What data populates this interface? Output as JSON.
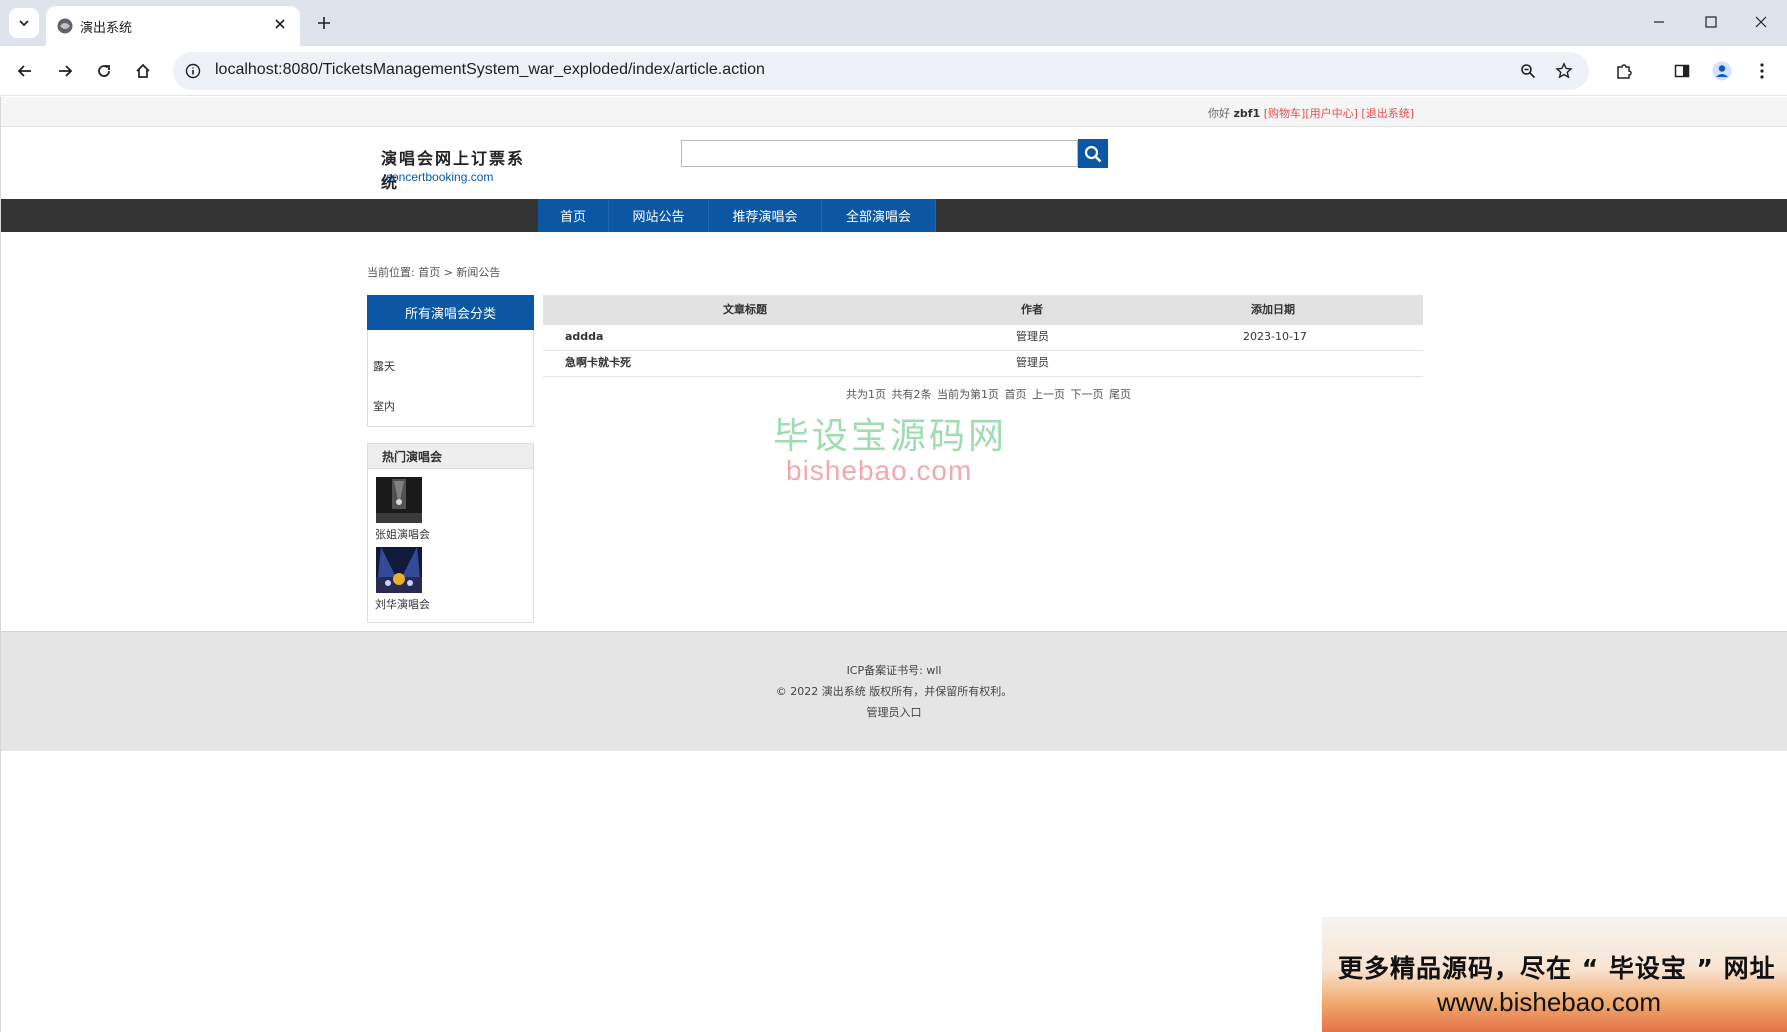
{
  "browser": {
    "tab_title": "演出系统",
    "url": "localhost:8080/TicketsManagementSystem_war_exploded/index/article.action"
  },
  "topbar": {
    "greeting": "你好",
    "username": "zbf1",
    "cart_link": "[购物车]",
    "user_center_link": "[用户中心]",
    "logout_link": "[退出系统]"
  },
  "header": {
    "logo_cn": "演唱会网上订票系统",
    "logo_en": "concertbooking.com",
    "search_placeholder": ""
  },
  "nav": {
    "items": [
      {
        "label": "首页"
      },
      {
        "label": "网站公告"
      },
      {
        "label": "推荐演唱会"
      },
      {
        "label": "全部演唱会"
      }
    ]
  },
  "breadcrumb": "当前位置: 首页 > 新闻公告",
  "sidebar": {
    "categories_title": "所有演唱会分类",
    "categories": [
      {
        "label": "露天"
      },
      {
        "label": "室内"
      }
    ],
    "hot_title": "热门演唱会",
    "hot": [
      {
        "label": "张姐演唱会"
      },
      {
        "label": "刘华演唱会"
      }
    ]
  },
  "articles": {
    "headers": {
      "title": "文章标题",
      "author": "作者",
      "date": "添加日期"
    },
    "rows": [
      {
        "title": "addda",
        "author": "管理员",
        "date": "2023-10-17"
      },
      {
        "title": "急啊卡就卡死",
        "author": "管理员",
        "date": ""
      }
    ],
    "pager": {
      "total_pages": "共为1页",
      "total_items": "共有2条",
      "current": "当前为第1页",
      "first": "首页",
      "prev": "上一页",
      "next": "下一页",
      "last": "尾页"
    }
  },
  "watermark": {
    "cn": "毕设宝源码网",
    "en": "bishebao.com"
  },
  "footer": {
    "icp": "ICP备案证书号: wll",
    "copyright": "© 2022 演出系统 版权所有，并保留所有权利。",
    "admin_link": "管理员入口"
  },
  "promo": {
    "line1": "更多精品源码，尽在 “ 毕设宝 ” 网址 :",
    "line2": "www.bishebao.com"
  }
}
